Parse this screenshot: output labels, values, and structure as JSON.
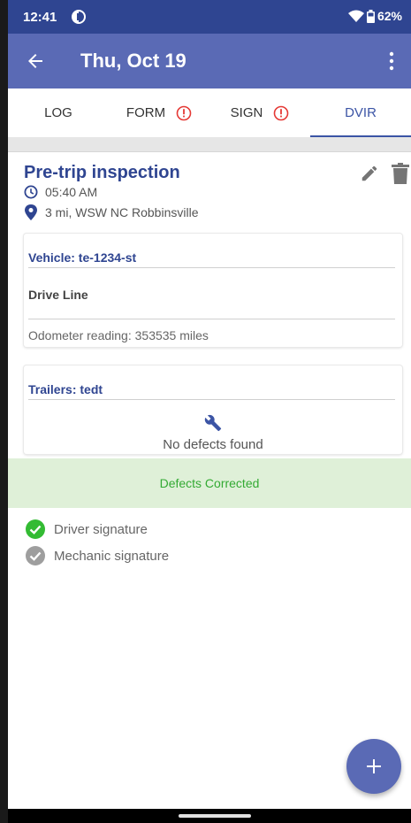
{
  "status_bar": {
    "time": "12:41",
    "battery": "62%"
  },
  "app_bar": {
    "title": "Thu, Oct 19"
  },
  "tabs": [
    {
      "label": "LOG",
      "alert": false,
      "active": false
    },
    {
      "label": "FORM",
      "alert": true,
      "active": false
    },
    {
      "label": "SIGN",
      "alert": true,
      "active": false
    },
    {
      "label": "DVIR",
      "alert": false,
      "active": true
    }
  ],
  "inspection": {
    "title": "Pre-trip inspection",
    "time": "05:40 AM",
    "location": "3 mi, WSW NC Robbinsville"
  },
  "vehicle_card": {
    "heading": "Vehicle: te-1234-st",
    "defect": "Drive Line",
    "odometer": "Odometer reading: 353535 miles"
  },
  "trailers_card": {
    "heading": "Trailers: tedt",
    "status": "No defects found"
  },
  "defects_status": "Defects Corrected",
  "signatures": [
    {
      "label": "Driver signature",
      "signed": true
    },
    {
      "label": "Mechanic signature",
      "signed": false
    }
  ],
  "colors": {
    "primary": "#5a6ab5",
    "status_bar": "#2f4591",
    "accent_blue": "#3b54a5",
    "alert_red": "#e53935",
    "success_green": "#33aa33",
    "success_bg": "#dff0d8"
  }
}
